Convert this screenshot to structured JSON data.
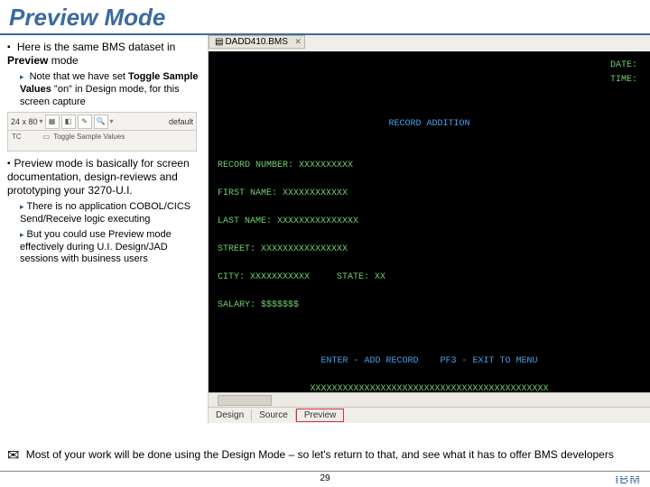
{
  "title": "Preview Mode",
  "left": {
    "b1_a": "Here is the same BMS dataset in ",
    "b1_bold": "Preview",
    "b1_b": " mode",
    "s1_a": "Note that we have set ",
    "s1_bold": "Toggle Sample Values",
    "s1_b": " \"on\" in Design mode, for this screen capture",
    "b2": "Preview mode is basically for screen documentation, design-reviews and prototyping your 3270-U.I.",
    "s2": "There is no application COBOL/CICS Send/Receive logic executing",
    "s3": "But you could use Preview mode effectively during U.I. Design/JAD sessions with business users",
    "toolbar_left": "24 x 80",
    "toolbar_bot_default": "default",
    "toolbar_bot_toggle": "Toggle Sample Values",
    "toolbar_bot_tc": "TC"
  },
  "editor_tab": "DADD410.BMS",
  "terminal": {
    "date": "DATE:",
    "time": "TIME:",
    "heading": "RECORD ADDITION",
    "rec": "RECORD NUMBER: XXXXXXXXXX",
    "first": "FIRST NAME: XXXXXXXXXXXX",
    "last": "LAST NAME: XXXXXXXXXXXXXXX",
    "street": "STREET: XXXXXXXXXXXXXXXX",
    "city": "CITY: XXXXXXXXXXX",
    "state": "STATE: XX",
    "salary": "SALARY: $$$$$$$",
    "foot1": "ENTER - ADD RECORD    PF3 - EXIT TO MENU",
    "foot2": "XXXXXXXXXXXXXXXXXXXXXXXXXXXXXXXXXXXXXXXXXXXX"
  },
  "tabs": {
    "design": "Design",
    "source": "Source",
    "preview": "Preview"
  },
  "footer_note": "Most of your work will be done using the Design Mode – so let's return to that, and see what it has to offer BMS developers",
  "page_number": "29",
  "ibm": "IBM"
}
